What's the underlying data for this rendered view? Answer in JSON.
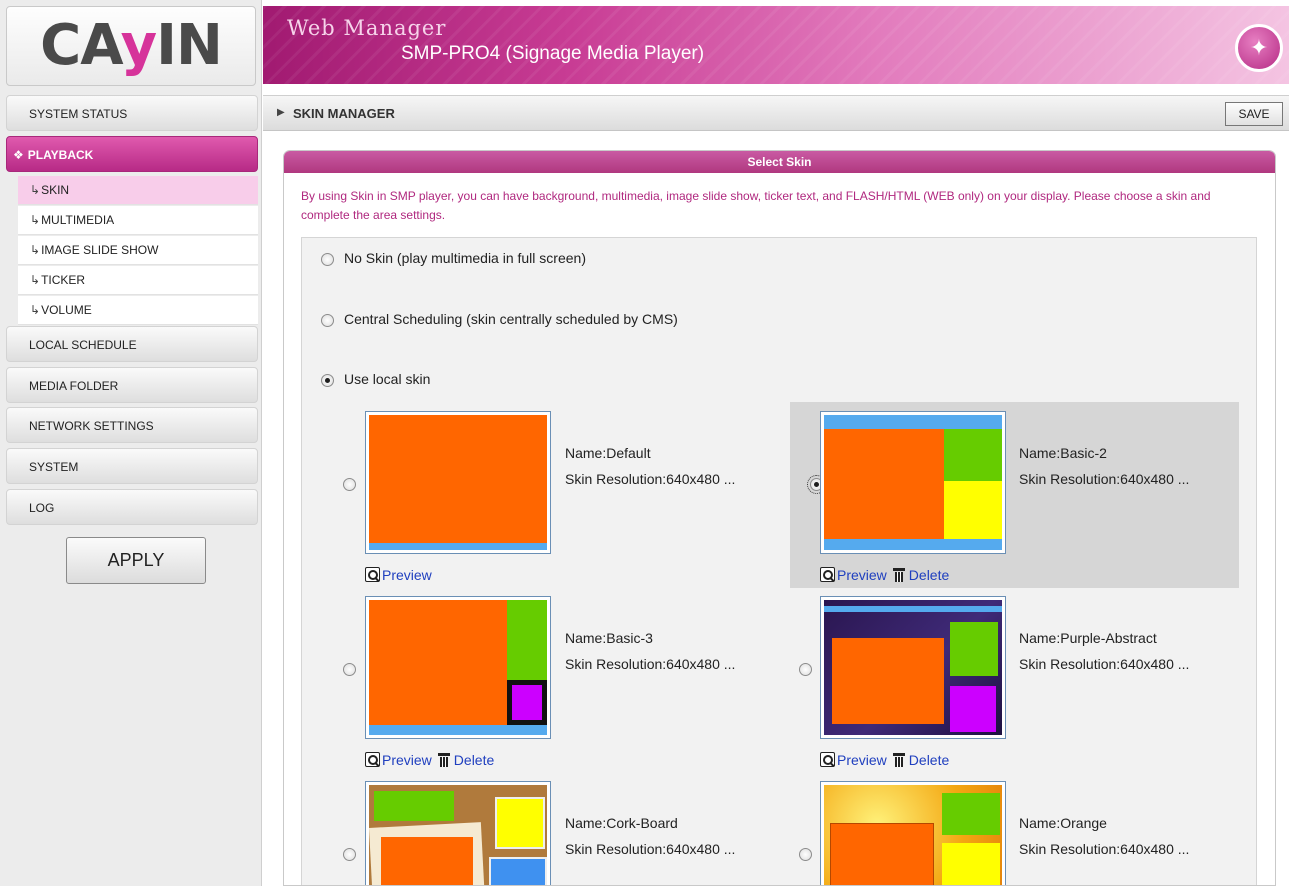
{
  "logo": {
    "brand": "CAYIN"
  },
  "header": {
    "title": "Web Manager",
    "subtitle": "SMP-PRO4 (Signage Media Player)"
  },
  "sidebar": {
    "items": [
      {
        "label": "SYSTEM STATUS"
      },
      {
        "label": "PLAYBACK"
      },
      {
        "label": "LOCAL SCHEDULE"
      },
      {
        "label": "MEDIA FOLDER"
      },
      {
        "label": "NETWORK SETTINGS"
      },
      {
        "label": "SYSTEM"
      },
      {
        "label": "LOG"
      }
    ],
    "subitems": [
      {
        "label": "SKIN"
      },
      {
        "label": "MULTIMEDIA"
      },
      {
        "label": "IMAGE SLIDE SHOW"
      },
      {
        "label": "TICKER"
      },
      {
        "label": "VOLUME"
      }
    ],
    "apply_label": "APPLY"
  },
  "breadcrumb": {
    "label": "SKIN MANAGER"
  },
  "toolbar": {
    "save_label": "SAVE"
  },
  "panel": {
    "title": "Select Skin",
    "description": "By using Skin in SMP player, you can have background, multimedia, image slide show, ticker text, and FLASH/HTML (WEB only) on your display. Please choose a skin and complete the area settings."
  },
  "options": [
    {
      "label": "No Skin (play multimedia in full screen)"
    },
    {
      "label": "Central Scheduling (skin centrally scheduled by CMS)"
    },
    {
      "label": "Use local skin",
      "selected": true
    }
  ],
  "skins": [
    {
      "name": "Name:Default",
      "resolution": "Skin Resolution:640x480 ...",
      "preview": "Preview"
    },
    {
      "name": "Name:Basic-2",
      "resolution": "Skin Resolution:640x480 ...",
      "preview": "Preview",
      "delete": "Delete",
      "selected": true
    },
    {
      "name": "Name:Basic-3",
      "resolution": "Skin Resolution:640x480 ...",
      "preview": "Preview",
      "delete": "Delete"
    },
    {
      "name": "Name:Purple-Abstract",
      "resolution": "Skin Resolution:640x480 ...",
      "preview": "Preview",
      "delete": "Delete"
    },
    {
      "name": "Name:Cork-Board",
      "resolution": "Skin Resolution:640x480 ..."
    },
    {
      "name": "Name:Orange",
      "resolution": "Skin Resolution:640x480 ..."
    }
  ],
  "colors": {
    "accent": "#b72a86",
    "area_orange": "#ff6600",
    "area_green": "#66cc00",
    "area_yellow": "#ffff00",
    "area_purple": "#cc00ff",
    "area_blue": "#55aaee",
    "link": "#1f3fbf"
  },
  "icons": [
    "wand-icon",
    "magnifier-icon",
    "trash-icon",
    "triangle-right-icon",
    "sub-arrow-icon",
    "radio-icon"
  ]
}
